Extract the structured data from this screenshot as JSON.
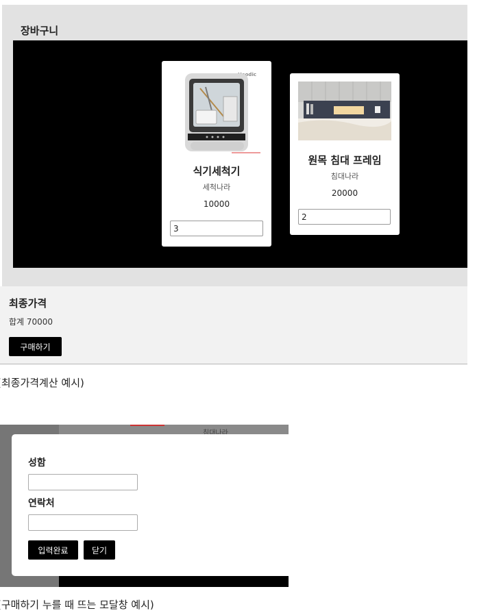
{
  "cart": {
    "title": "장바구니",
    "products": [
      {
        "name": "식기세척기",
        "brand": "세척나라",
        "price": "10000",
        "quantity": "3",
        "image_label": "Hoodic"
      },
      {
        "name": "원목 침대 프레임",
        "brand": "침대나라",
        "price": "20000",
        "quantity": "2"
      }
    ]
  },
  "total": {
    "title": "최종가격",
    "amount": "합계 70000",
    "buy_label": "구매하기"
  },
  "captions": {
    "total_example": "(최종가격계산 예시)",
    "modal_example": "(구매하기 누를 때 뜨는 모달창 예시)"
  },
  "modal": {
    "background_text": "침대나라",
    "name_label": "성함",
    "phone_label": "연락처",
    "name_value": "",
    "phone_value": "",
    "submit_label": "입력완료",
    "close_label": "닫기"
  }
}
